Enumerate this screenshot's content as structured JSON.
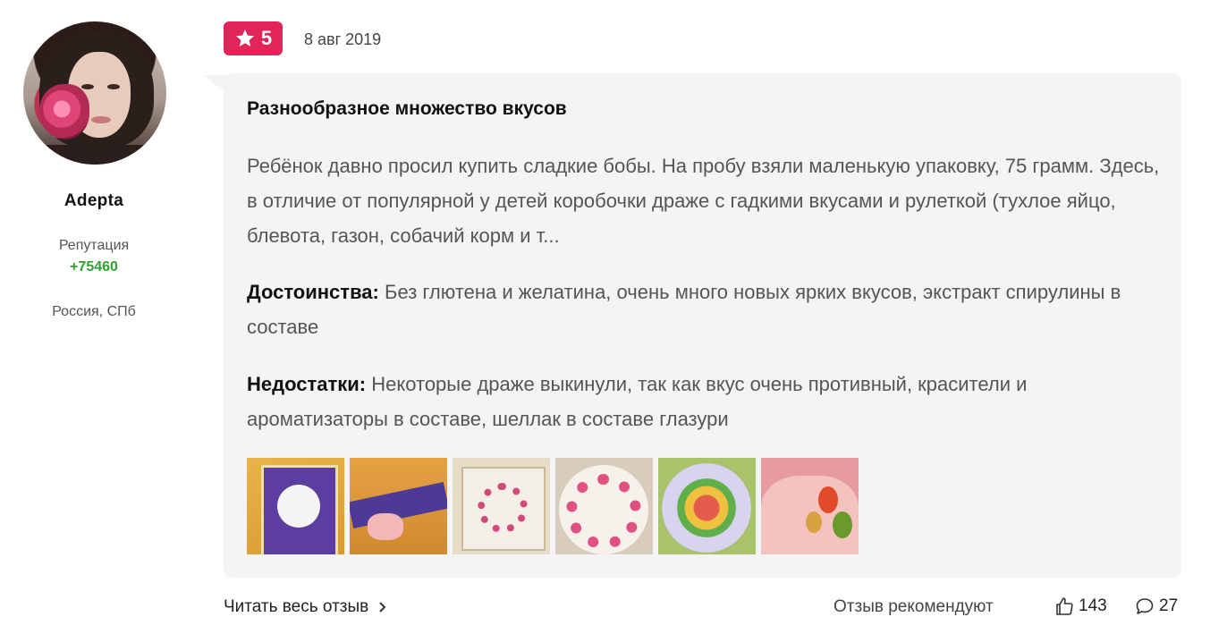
{
  "user": {
    "name": "Adepta",
    "reputation_label": "Репутация",
    "reputation_value": "+75460",
    "location": "Россия, СПб"
  },
  "review": {
    "rating": "5",
    "date": "8 авг 2019",
    "title": "Разнообразное множество вкусов",
    "text": "Ребёнок давно просил купить сладкие бобы. На пробу взяли маленькую упаковку, 75 грамм. Здесь, в отличие от популярной у детей коробочки драже с гадкими вкусами и рулеткой (тухлое яйцо, блевота, газон, собачий корм и т...",
    "pros_label": "Достоинства:",
    "pros": "Без глютена и желатина, очень много новых ярких вкусов, экстракт спирулины в составе",
    "cons_label": "Недостатки:",
    "cons": "Некоторые драже выкинули, так как вкус очень противный, красители и ароматизаторы в составе, шеллак в составе глазури",
    "images": [
      "jelly-bean-box",
      "jelly-bean-stick",
      "box-lid",
      "box-open-plate",
      "beans-in-bowl",
      "beans-in-hand"
    ]
  },
  "footer": {
    "read_more": "Читать весь отзыв",
    "recommend_label": "Отзыв рекомендуют",
    "likes": "143",
    "comments": "27"
  },
  "icons": {
    "star": "star-icon",
    "chevron": "chevron-right-icon",
    "like": "thumbs-up-icon",
    "comment": "comment-icon"
  },
  "colors": {
    "rating_badge": "#e3245a",
    "reputation": "#2fa12f",
    "card_bg": "#f4f4f6"
  }
}
